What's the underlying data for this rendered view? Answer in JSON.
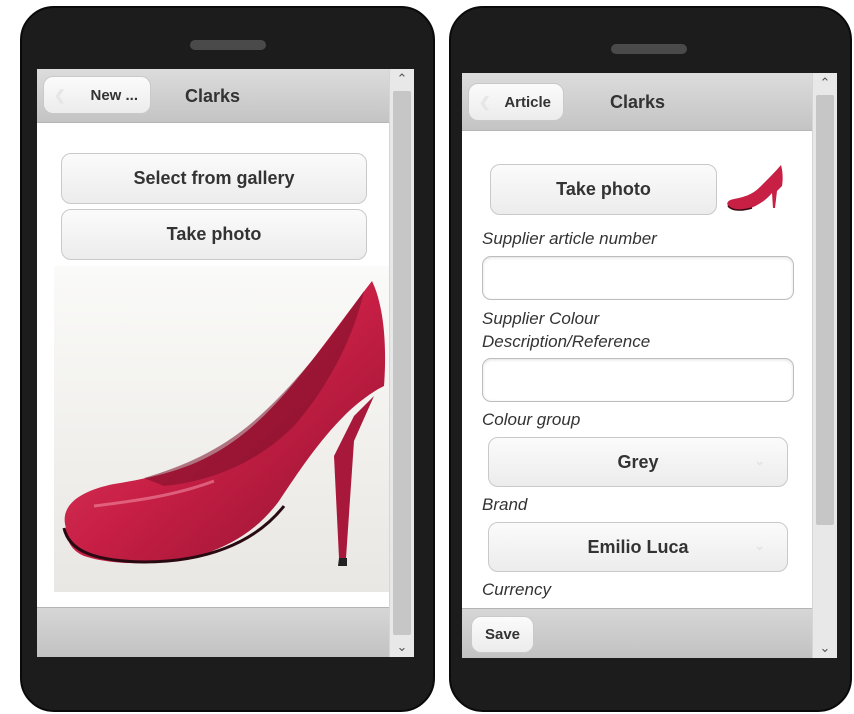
{
  "left_screen": {
    "back_label": "New ...",
    "title": "Clarks",
    "select_gallery_label": "Select from gallery",
    "take_photo_label": "Take photo"
  },
  "right_screen": {
    "back_label": "Article",
    "title": "Clarks",
    "take_photo_label": "Take photo",
    "supplier_article_label": "Supplier article number",
    "supplier_article_value": "",
    "supplier_colour_label_1": "Supplier Colour",
    "supplier_colour_label_2": "Description/Reference",
    "supplier_colour_value": "",
    "colour_group_label": "Colour group",
    "colour_group_value": "Grey",
    "brand_label": "Brand",
    "brand_value": "Emilio Luca",
    "currency_label": "Currency",
    "save_label": "Save"
  },
  "icons": {
    "back": "chevron-left-icon",
    "select_arrow": "chevron-down-icon",
    "scroll_up": "scroll-up-arrow-icon",
    "scroll_down": "scroll-down-arrow-icon"
  },
  "colors": {
    "shoe": "#c81f45",
    "phone_body": "#1c1c1c",
    "header_bar": "#cfcfcf"
  }
}
